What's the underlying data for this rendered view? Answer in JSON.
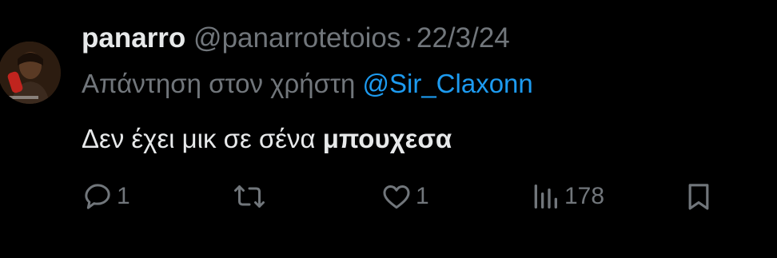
{
  "tweet": {
    "display_name": "panarro",
    "handle": "@panarrotetoios",
    "separator": "·",
    "date": "22/3/24",
    "reply_prefix": "Απάντηση στον χρήστη",
    "reply_mention": "@Sir_Claxonn",
    "body_plain": "Δεν έχει μικ σε σένα",
    "body_bold": "μπουχεσα",
    "avatar_icon": "profile-photo-man-red-phone"
  },
  "actions": {
    "reply": {
      "icon": "comment-icon",
      "count": "1"
    },
    "retweet": {
      "icon": "retweet-icon",
      "count": ""
    },
    "like": {
      "icon": "heart-icon",
      "count": "1"
    },
    "views": {
      "icon": "analytics-icon",
      "count": "178"
    },
    "bookmark": {
      "icon": "bookmark-icon",
      "count": ""
    }
  },
  "colors": {
    "background": "#000000",
    "text_primary": "#e7e9ea",
    "text_secondary": "#71767b",
    "mention": "#1d9bf0"
  }
}
